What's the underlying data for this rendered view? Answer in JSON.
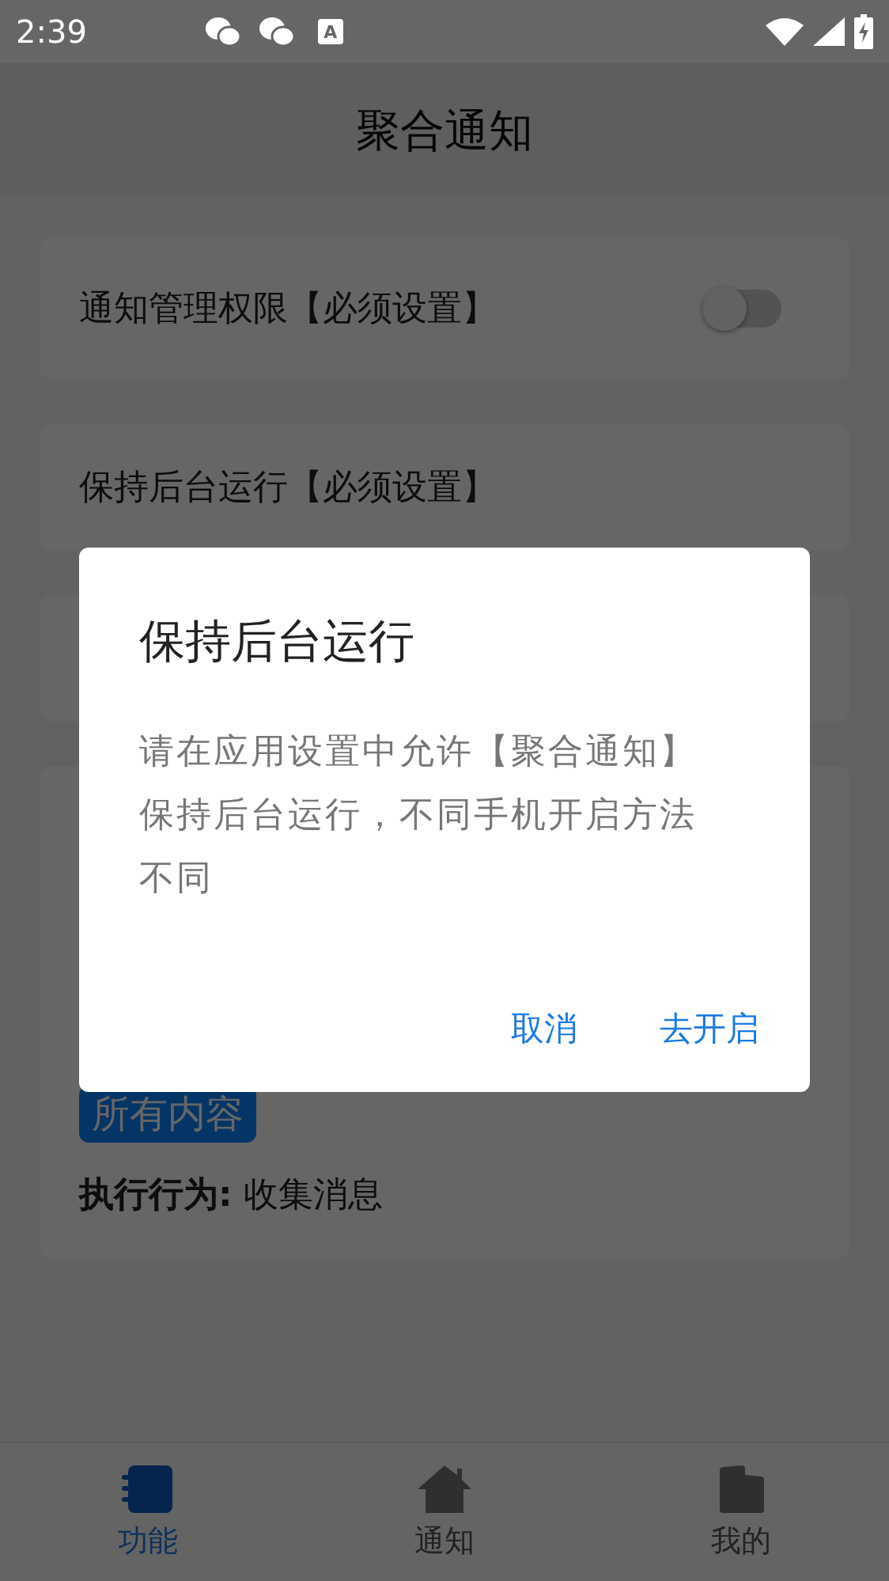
{
  "status_bar": {
    "time": "2:39",
    "badge": "A"
  },
  "header": {
    "title": "聚合通知"
  },
  "cards": [
    {
      "kind": "switch",
      "label": "通知管理权限【必须设置】",
      "on": false
    },
    {
      "kind": "text",
      "label": "保持后台运行【必须设置】"
    },
    {
      "kind": "blank"
    },
    {
      "kind": "rule",
      "tag": "所有内容",
      "action": "**执行行为:** 收集消息"
    }
  ],
  "dialog": {
    "title": "保持后台运行",
    "message": "请在应用设置中允许【聚合通知】保持后台运行，不同手机开启方法不同",
    "buttons": [
      "取消",
      "去开启"
    ]
  },
  "nav": [
    {
      "label": "功能",
      "selected": true
    },
    {
      "label": "通知",
      "selected": false
    },
    {
      "label": "我的",
      "selected": false
    }
  ]
}
